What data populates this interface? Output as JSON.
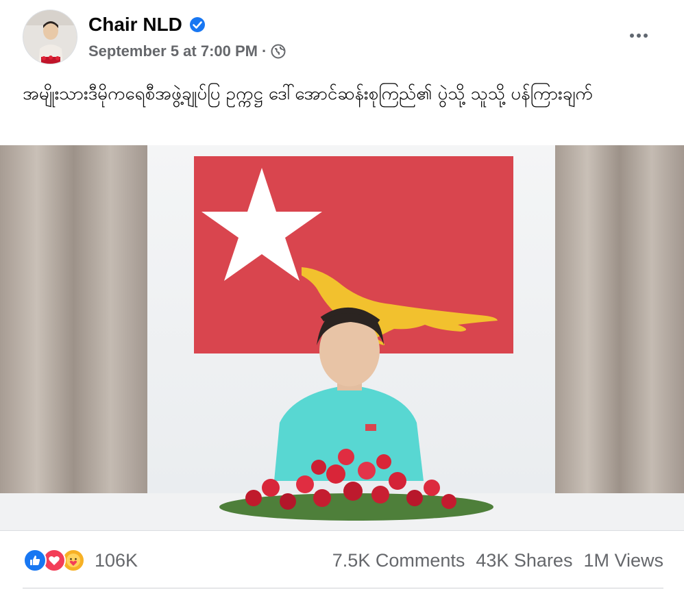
{
  "post": {
    "page_name": "Chair NLD",
    "timestamp": "September 5 at 7:00 PM",
    "separator": "·",
    "audience_icon": "globe-icon",
    "verified_icon": "verified-badge-icon",
    "more_icon": "more-options-icon",
    "caption": "အမျိုးသားဒီမိုကရေစီအဖွဲ့ချုပ်ပြ ဥက္ကဋ္ဌ ဒေါ်အောင်ဆန်းစုကြည်၏ ပွဲသို့ သူသို့ ပန်ကြားချက်"
  },
  "video": {
    "content": "speaker-at-desk-with-flag"
  },
  "engagement": {
    "reaction_icons": [
      "like-icon",
      "love-icon",
      "care-icon"
    ],
    "reaction_count": "106K",
    "comments": "7.5K Comments",
    "shares": "43K Shares",
    "views": "1M Views"
  },
  "colors": {
    "accent_blue": "#1877f2",
    "love_red": "#f33e58",
    "care_yellow": "#f7b125",
    "flag_red": "#d9454e",
    "flag_gold": "#f2c12e",
    "secondary_text": "#65676b"
  }
}
